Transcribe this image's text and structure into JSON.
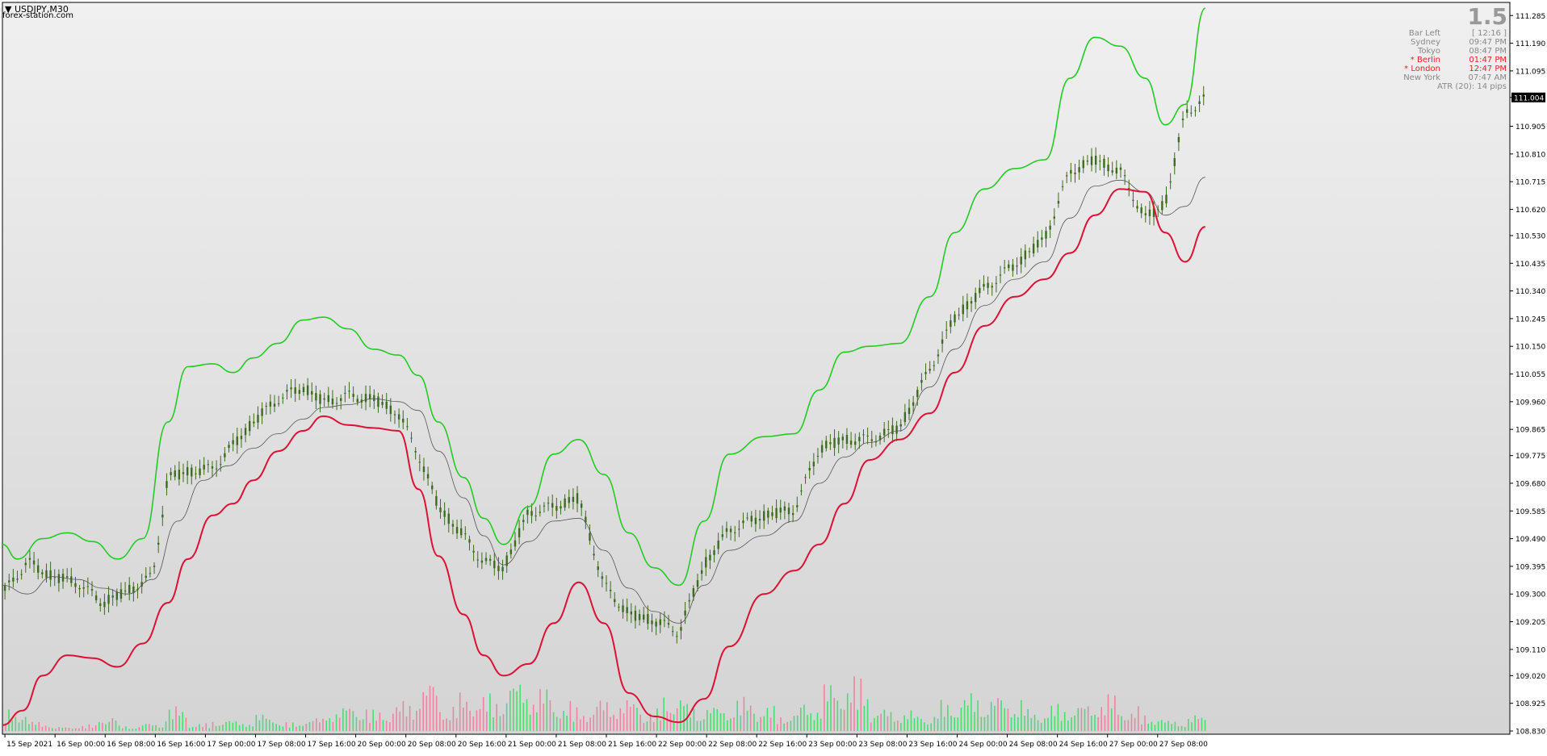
{
  "window": {
    "symbol": "USDJPY,M30",
    "site": "forex-station.com"
  },
  "info_panel": {
    "big_number": "1.5",
    "rows": [
      {
        "label": "Bar Left",
        "value": "[ 12:16 ]",
        "highlight": false
      },
      {
        "label": "Sydney",
        "value": "09:47 PM",
        "highlight": false
      },
      {
        "label": "Tokyo",
        "value": "08:47 PM",
        "highlight": false
      },
      {
        "label": "* Berlin",
        "value": "01:47 PM",
        "highlight": true
      },
      {
        "label": "* London",
        "value": "12:47 PM",
        "highlight": true
      },
      {
        "label": "New York",
        "value": "07:47 AM",
        "highlight": false
      },
      {
        "label": "ATR (20): 14 pips",
        "value": "",
        "highlight": false
      }
    ]
  },
  "colors": {
    "upper_band": "#22cc22",
    "lower_band": "#dd1133",
    "middle_line": "#555555",
    "candle": "#3d6b1f",
    "volume_up": "#33dd66",
    "volume_down": "#ee7799"
  },
  "chart_data": {
    "type": "line",
    "symbol": "USDJPY",
    "timeframe": "M30",
    "ylim": [
      108.83,
      111.33
    ],
    "y_ticks": [
      "111.285",
      "111.190",
      "111.095",
      "111.004",
      "110.905",
      "110.810",
      "110.715",
      "110.620",
      "110.530",
      "110.435",
      "110.340",
      "110.245",
      "110.150",
      "110.055",
      "109.960",
      "109.865",
      "109.775",
      "109.680",
      "109.585",
      "109.490",
      "109.395",
      "109.300",
      "109.205",
      "109.110",
      "109.020",
      "108.925",
      "108.830"
    ],
    "current_price": "111.004",
    "x_ticks": [
      "15 Sep 2021",
      "16 Sep 00:00",
      "16 Sep 08:00",
      "16 Sep 16:00",
      "17 Sep 00:00",
      "17 Sep 08:00",
      "17 Sep 16:00",
      "20 Sep 00:00",
      "20 Sep 08:00",
      "20 Sep 16:00",
      "21 Sep 00:00",
      "21 Sep 08:00",
      "21 Sep 16:00",
      "22 Sep 00:00",
      "22 Sep 08:00",
      "22 Sep 16:00",
      "23 Sep 00:00",
      "23 Sep 08:00",
      "23 Sep 16:00",
      "24 Sep 00:00",
      "24 Sep 08:00",
      "24 Sep 16:00",
      "27 Sep 00:00",
      "27 Sep 08:00"
    ],
    "x_range": [
      0,
      24.6
    ],
    "series": [
      {
        "key": "upper",
        "points": [
          [
            0,
            109.47
          ],
          [
            0.3,
            109.42
          ],
          [
            0.8,
            109.49
          ],
          [
            1.3,
            109.51
          ],
          [
            1.8,
            109.48
          ],
          [
            2.3,
            109.42
          ],
          [
            2.8,
            109.49
          ],
          [
            3.3,
            109.89
          ],
          [
            3.7,
            110.08
          ],
          [
            4.2,
            110.09
          ],
          [
            4.6,
            110.06
          ],
          [
            5.0,
            110.11
          ],
          [
            5.5,
            110.16
          ],
          [
            6.0,
            110.24
          ],
          [
            6.4,
            110.25
          ],
          [
            6.9,
            110.21
          ],
          [
            7.4,
            110.14
          ],
          [
            7.9,
            110.12
          ],
          [
            8.3,
            110.05
          ],
          [
            8.7,
            109.89
          ],
          [
            9.2,
            109.7
          ],
          [
            9.6,
            109.56
          ],
          [
            10.0,
            109.47
          ],
          [
            10.5,
            109.6
          ],
          [
            11.0,
            109.78
          ],
          [
            11.5,
            109.83
          ],
          [
            12.0,
            109.71
          ],
          [
            12.5,
            109.51
          ],
          [
            13.0,
            109.39
          ],
          [
            13.5,
            109.33
          ],
          [
            14.0,
            109.55
          ],
          [
            14.5,
            109.78
          ],
          [
            15.2,
            109.84
          ],
          [
            15.8,
            109.85
          ],
          [
            16.3,
            110.0
          ],
          [
            16.8,
            110.13
          ],
          [
            17.3,
            110.15
          ],
          [
            17.9,
            110.16
          ],
          [
            18.5,
            110.32
          ],
          [
            19.0,
            110.54
          ],
          [
            19.6,
            110.69
          ],
          [
            20.2,
            110.76
          ],
          [
            20.8,
            110.79
          ],
          [
            21.3,
            111.07
          ],
          [
            21.8,
            111.21
          ],
          [
            22.3,
            111.18
          ],
          [
            22.8,
            111.07
          ],
          [
            23.2,
            110.91
          ],
          [
            23.6,
            110.98
          ],
          [
            24.0,
            111.31
          ]
        ]
      },
      {
        "key": "middle",
        "points": [
          [
            0,
            109.33
          ],
          [
            0.5,
            109.3
          ],
          [
            1.0,
            109.36
          ],
          [
            1.5,
            109.35
          ],
          [
            2.0,
            109.32
          ],
          [
            2.5,
            109.3
          ],
          [
            3.0,
            109.35
          ],
          [
            3.5,
            109.55
          ],
          [
            4.0,
            109.69
          ],
          [
            4.5,
            109.74
          ],
          [
            5.0,
            109.8
          ],
          [
            5.5,
            109.85
          ],
          [
            6.0,
            109.9
          ],
          [
            6.4,
            109.94
          ],
          [
            6.9,
            109.95
          ],
          [
            7.4,
            109.97
          ],
          [
            7.9,
            109.96
          ],
          [
            8.3,
            109.93
          ],
          [
            8.7,
            109.79
          ],
          [
            9.2,
            109.63
          ],
          [
            9.6,
            109.5
          ],
          [
            10.0,
            109.4
          ],
          [
            10.5,
            109.48
          ],
          [
            11.0,
            109.55
          ],
          [
            11.5,
            109.56
          ],
          [
            12.0,
            109.45
          ],
          [
            12.5,
            109.32
          ],
          [
            13.0,
            109.24
          ],
          [
            13.5,
            109.2
          ],
          [
            14.0,
            109.33
          ],
          [
            14.5,
            109.45
          ],
          [
            15.2,
            109.5
          ],
          [
            15.8,
            109.55
          ],
          [
            16.3,
            109.68
          ],
          [
            16.8,
            109.77
          ],
          [
            17.3,
            109.82
          ],
          [
            17.9,
            109.86
          ],
          [
            18.5,
            110.01
          ],
          [
            19.0,
            110.14
          ],
          [
            19.6,
            110.29
          ],
          [
            20.2,
            110.38
          ],
          [
            20.8,
            110.44
          ],
          [
            21.3,
            110.59
          ],
          [
            21.8,
            110.7
          ],
          [
            22.3,
            110.72
          ],
          [
            22.8,
            110.68
          ],
          [
            23.2,
            110.6
          ],
          [
            23.6,
            110.63
          ],
          [
            24.0,
            110.73
          ]
        ]
      },
      {
        "key": "lower",
        "points": [
          [
            0,
            108.85
          ],
          [
            0.4,
            108.9
          ],
          [
            0.8,
            109.02
          ],
          [
            1.3,
            109.09
          ],
          [
            1.8,
            109.08
          ],
          [
            2.3,
            109.05
          ],
          [
            2.8,
            109.13
          ],
          [
            3.3,
            109.27
          ],
          [
            3.7,
            109.42
          ],
          [
            4.2,
            109.57
          ],
          [
            4.6,
            109.61
          ],
          [
            5.0,
            109.69
          ],
          [
            5.5,
            109.79
          ],
          [
            6.0,
            109.86
          ],
          [
            6.4,
            109.91
          ],
          [
            6.9,
            109.88
          ],
          [
            7.4,
            109.87
          ],
          [
            7.9,
            109.86
          ],
          [
            8.3,
            109.66
          ],
          [
            8.7,
            109.43
          ],
          [
            9.2,
            109.23
          ],
          [
            9.6,
            109.09
          ],
          [
            10.0,
            109.02
          ],
          [
            10.5,
            109.06
          ],
          [
            11.0,
            109.2
          ],
          [
            11.5,
            109.34
          ],
          [
            12.0,
            109.2
          ],
          [
            12.5,
            108.96
          ],
          [
            13.0,
            108.88
          ],
          [
            13.5,
            108.86
          ],
          [
            14.0,
            108.94
          ],
          [
            14.5,
            109.12
          ],
          [
            15.2,
            109.3
          ],
          [
            15.8,
            109.38
          ],
          [
            16.3,
            109.47
          ],
          [
            16.8,
            109.61
          ],
          [
            17.3,
            109.76
          ],
          [
            17.9,
            109.83
          ],
          [
            18.5,
            109.92
          ],
          [
            19.0,
            110.06
          ],
          [
            19.6,
            110.22
          ],
          [
            20.2,
            110.32
          ],
          [
            20.8,
            110.38
          ],
          [
            21.3,
            110.47
          ],
          [
            21.8,
            110.6
          ],
          [
            22.3,
            110.69
          ],
          [
            22.8,
            110.68
          ],
          [
            23.2,
            110.54
          ],
          [
            23.6,
            110.44
          ],
          [
            24.0,
            110.56
          ]
        ]
      }
    ],
    "price_path": [
      [
        0,
        109.3
      ],
      [
        0.5,
        109.41
      ],
      [
        1.0,
        109.36
      ],
      [
        1.5,
        109.34
      ],
      [
        2.0,
        109.27
      ],
      [
        2.5,
        109.31
      ],
      [
        3.0,
        109.36
      ],
      [
        3.3,
        109.7
      ],
      [
        3.7,
        109.72
      ],
      [
        4.2,
        109.73
      ],
      [
        4.6,
        109.81
      ],
      [
        5.0,
        109.89
      ],
      [
        5.5,
        109.97
      ],
      [
        6.0,
        110.01
      ],
      [
        6.4,
        109.96
      ],
      [
        6.9,
        109.98
      ],
      [
        7.4,
        109.97
      ],
      [
        7.9,
        109.92
      ],
      [
        8.3,
        109.78
      ],
      [
        8.7,
        109.6
      ],
      [
        9.2,
        109.5
      ],
      [
        9.6,
        109.41
      ],
      [
        10.0,
        109.39
      ],
      [
        10.5,
        109.58
      ],
      [
        11.0,
        109.6
      ],
      [
        11.5,
        109.63
      ],
      [
        12.0,
        109.33
      ],
      [
        12.5,
        109.23
      ],
      [
        13.0,
        109.21
      ],
      [
        13.5,
        109.17
      ],
      [
        14.0,
        109.4
      ],
      [
        14.5,
        109.52
      ],
      [
        15.2,
        109.57
      ],
      [
        15.8,
        109.59
      ],
      [
        16.3,
        109.8
      ],
      [
        16.8,
        109.83
      ],
      [
        17.3,
        109.83
      ],
      [
        17.9,
        109.87
      ],
      [
        18.5,
        110.07
      ],
      [
        19.0,
        110.25
      ],
      [
        19.6,
        110.35
      ],
      [
        20.2,
        110.43
      ],
      [
        20.8,
        110.52
      ],
      [
        21.3,
        110.75
      ],
      [
        21.8,
        110.79
      ],
      [
        22.3,
        110.75
      ],
      [
        22.8,
        110.59
      ],
      [
        23.2,
        110.64
      ],
      [
        23.6,
        110.95
      ],
      [
        24.0,
        111.0
      ]
    ],
    "volume": [
      0.4,
      0.18,
      0.08,
      0.12,
      0.3,
      0.1,
      0.15,
      0.45,
      0.14,
      0.22,
      0.2,
      0.32,
      0.16,
      0.25,
      0.45,
      0.5,
      0.38,
      0.55,
      0.95,
      0.5,
      0.7,
      0.68,
      0.95,
      0.82,
      0.55,
      0.45,
      0.6,
      0.6,
      0.4,
      0.7,
      0.5,
      0.48,
      0.62,
      0.46,
      0.35,
      0.55,
      0.9,
      1.0,
      0.42,
      0.4,
      0.32,
      0.55,
      0.7,
      0.68,
      0.62,
      0.4,
      0.5,
      0.52,
      0.7,
      0.45,
      0.3,
      0.2,
      0.3
    ]
  }
}
